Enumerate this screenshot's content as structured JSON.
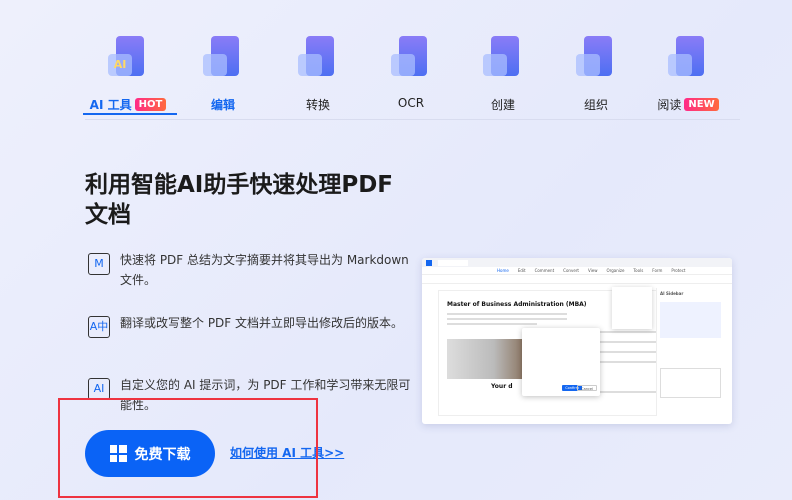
{
  "nav": {
    "items": [
      {
        "label": "AI 工具",
        "badge": "HOT",
        "icon": "ai-tools-icon",
        "active": true
      },
      {
        "label": "编辑",
        "icon": "edit-icon",
        "highlight": true
      },
      {
        "label": "转换",
        "icon": "convert-icon"
      },
      {
        "label": "OCR",
        "icon": "ocr-icon"
      },
      {
        "label": "创建",
        "icon": "create-icon"
      },
      {
        "label": "组织",
        "icon": "organize-icon"
      },
      {
        "label": "阅读",
        "badge": "NEW",
        "icon": "read-icon"
      }
    ]
  },
  "hero": {
    "title": "利用智能AI助手快速处理PDF文档"
  },
  "features": [
    {
      "icon": "markdown-icon",
      "glyph": "M",
      "text": "快速将 PDF 总结为文字摘要并将其导出为 Markdown 文件。"
    },
    {
      "icon": "translate-icon",
      "glyph": "A中",
      "text": "翻译或改写整个 PDF 文档并立即导出修改后的版本。"
    },
    {
      "icon": "ai-prompt-icon",
      "glyph": "AI",
      "text": "自定义您的 AI 提示词，为 PDF 工作和学习带来无限可能性。"
    }
  ],
  "cta": {
    "download_label": "免费下载",
    "link_label": "如何使用 AI 工具>>"
  },
  "screenshot": {
    "menu": [
      "Home",
      "Edit",
      "Comment",
      "Convert",
      "View",
      "Organize",
      "Tools",
      "Form",
      "Protect"
    ],
    "doc_title": "Master of Business Administration (MBA)",
    "heading2": "Your d",
    "sidebar_title": "AI Sidebar",
    "confirm": "Confirm",
    "cancel": "Cancel"
  },
  "colors": {
    "accent": "#1467f0",
    "button": "#0a63f6",
    "badge": "#ff2a88",
    "highlight_box": "#ee3340"
  }
}
